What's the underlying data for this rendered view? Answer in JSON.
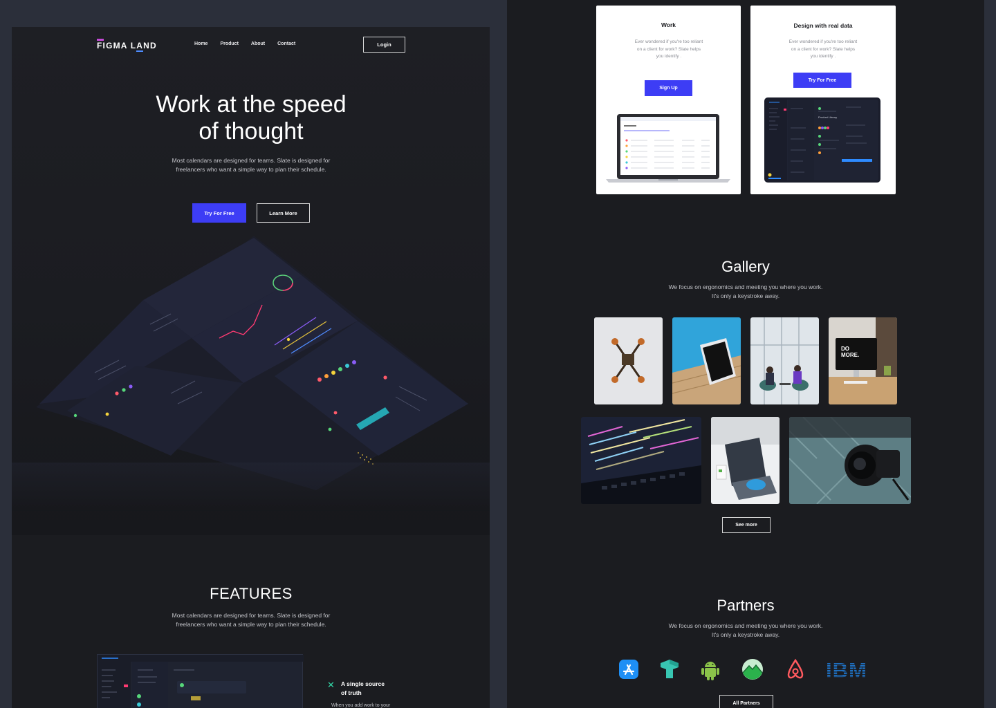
{
  "landing": {
    "logo": {
      "part1": "FIGMA L",
      "part2": "A",
      "part3": "ND"
    },
    "nav": [
      "Home",
      "Product",
      "About",
      "Contact"
    ],
    "login_label": "Login",
    "hero": {
      "title_line1": "Work at the speed",
      "title_line2": "of thought",
      "subtitle_line1": "Most calendars are designed for teams. Slate is designed for",
      "subtitle_line2": "freelancers who want a simple way to plan their schedule.",
      "primary_cta": "Try For Free",
      "secondary_cta": "Learn More"
    },
    "features": {
      "title": "FEATURES",
      "subtitle_line1": "Most calendars are designed for teams. Slate is designed for",
      "subtitle_line2": "freelancers who want a simple way to plan their schedule.",
      "item_heading_line1": "A single source",
      "item_heading_line2": "of truth",
      "item_text": "When you add work to your"
    }
  },
  "cards": [
    {
      "title": "Work",
      "text_line1": "Ever wondered if you're too reliant",
      "text_line2": "on a client for work? Slate helps",
      "text_line3": "you identify .",
      "button": "Sign Up"
    },
    {
      "title": "Design with real data",
      "text_line1": "Ever wondered if you're too reliant",
      "text_line2": "on a client for work? Slate helps",
      "text_line3": "you identify .",
      "button": "Try For Free"
    }
  ],
  "gallery": {
    "title": "Gallery",
    "subtitle_line1": "We focus on ergonomics and meeting you where you work.",
    "subtitle_line2": "It's only a keystroke away.",
    "images": [
      "drone-photo",
      "tablet-pool-photo",
      "office-meeting-photo",
      "do-more-desk-photo",
      "code-screen-photo",
      "laptop-hands-photo",
      "camera-photo"
    ],
    "see_more": "See more"
  },
  "partners": {
    "title": "Partners",
    "subtitle_line1": "We focus on ergonomics and meeting you where you work.",
    "subtitle_line2": "It's only a keystroke away.",
    "logos": [
      "app-store-icon",
      "codepen-t-icon",
      "android-icon",
      "basecamp-icon",
      "airbnb-icon",
      "ibm-logo"
    ],
    "ibm_text": "IBM",
    "all_partners": "All Partners"
  },
  "colors": {
    "canvas": "#2b2f3a",
    "frame": "#1b1c20",
    "accent": "#3d3df5",
    "text_muted": "#c3c4c9"
  }
}
